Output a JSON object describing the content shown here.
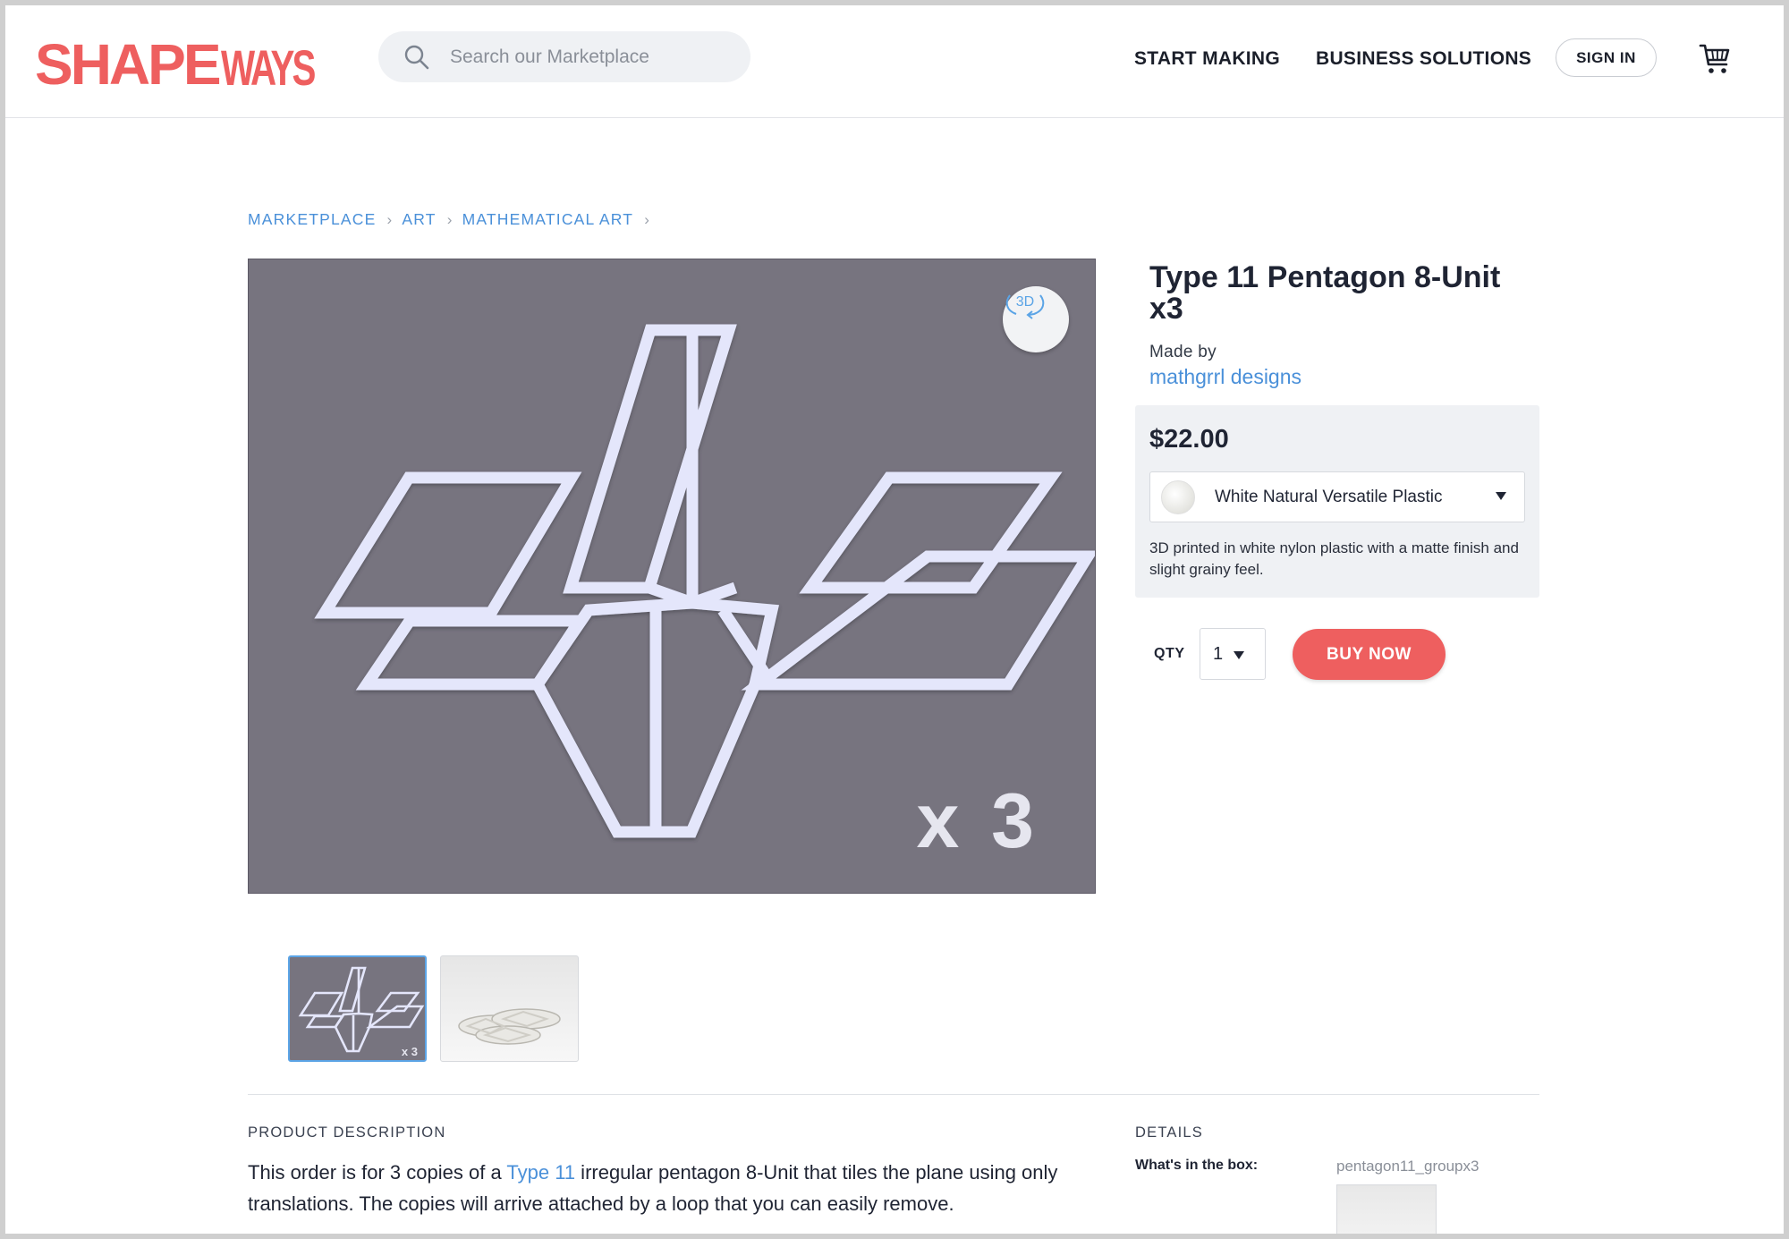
{
  "header": {
    "logo_part1": "SHAPE",
    "logo_part2": "WAYS",
    "search_placeholder": "Search our Marketplace",
    "nav_start": "START MAKING",
    "nav_business": "BUSINESS SOLUTIONS",
    "sign_in": "SIGN IN",
    "cart_icon": "cart-icon",
    "search_icon": "search-icon"
  },
  "breadcrumb": [
    "MARKETPLACE",
    "ART",
    "MATHEMATICAL ART"
  ],
  "gallery": {
    "badge_3d": "3D",
    "overlay_text": "x 3",
    "thumb_overlay": "x 3",
    "rotate_icon": "rotate-3d-icon"
  },
  "product": {
    "title": "Type 11 Pentagon 8-Unit x3",
    "made_by_label": "Made by",
    "designer": "mathgrrl designs",
    "price": "$22.00",
    "material": "White Natural Versatile Plastic",
    "material_description": "3D printed in white nylon plastic with a matte finish and slight grainy feel.",
    "qty_label": "QTY",
    "qty_value": "1",
    "buy_label": "BUY NOW"
  },
  "description": {
    "heading": "PRODUCT DESCRIPTION",
    "text_before_link": "This order is for 3 copies of a ",
    "link": "Type 11",
    "text_after_link": " irregular pentagon 8-Unit that tiles the plane using only translations.  The copies will arrive attached by a loop that you can easily remove."
  },
  "details": {
    "heading": "DETAILS",
    "box_label": "What's in the box:",
    "box_value": "pentagon11_groupx3"
  },
  "colors": {
    "brand": "#ee5f5f",
    "link": "#4a90d9",
    "image_bg": "#77747f",
    "model": "#e4e6fb"
  }
}
